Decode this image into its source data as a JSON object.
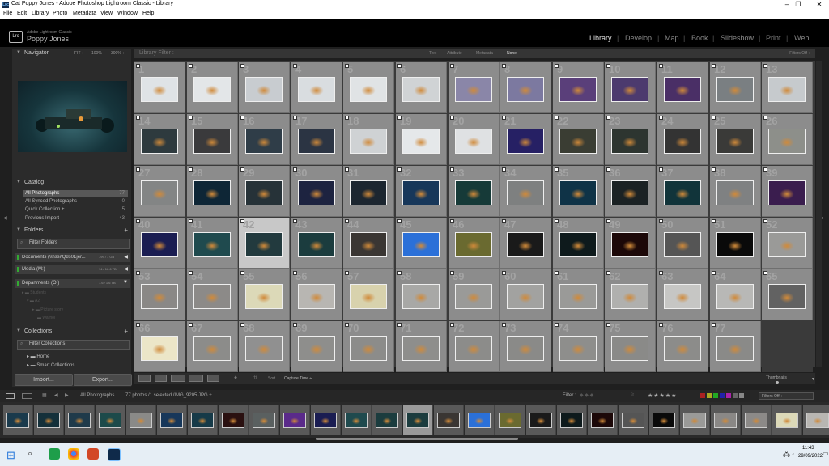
{
  "window": {
    "title": "Cat Poppy Jones - Adobe Photoshop Lightroom Classic - Library",
    "app_icon": "Lrc"
  },
  "menu": [
    "File",
    "Edit",
    "Library",
    "Photo",
    "Metadata",
    "View",
    "Window",
    "Help"
  ],
  "identity": {
    "logo": "Lrc",
    "subtitle": "Adobe Lightroom Classic",
    "name": "Poppy Jones"
  },
  "modules": [
    "Library",
    "Develop",
    "Map",
    "Book",
    "Slideshow",
    "Print",
    "Web"
  ],
  "active_module": "Library",
  "navigator": {
    "title": "Navigator",
    "zoom_options": [
      "FIT ÷",
      "100%",
      "300% ÷"
    ]
  },
  "catalog": {
    "title": "Catalog",
    "items": [
      {
        "label": "All Photographs",
        "count": "77",
        "selected": true
      },
      {
        "label": "All Synced Photographs",
        "count": "0"
      },
      {
        "label": "Quick Collection +",
        "count": "5"
      },
      {
        "label": "Previous Import",
        "count": "43"
      }
    ]
  },
  "folders": {
    "title": "Folders",
    "filter_label": "Filter Folders",
    "volumes": [
      {
        "label": "Documents (\\\\hssi\\Q8s01jer...",
        "stat": "799 / 1 GB"
      },
      {
        "label": "Media (M:)",
        "stat": "14 / 16.6 TB"
      },
      {
        "label": "Departments (O:)",
        "stat": "1.6 / 1.6 TB"
      }
    ],
    "tree": [
      "Students",
      "A2",
      "Picture story",
      "Warhol"
    ]
  },
  "collections": {
    "title": "Collections",
    "filter_label": "Filter Collections",
    "items": [
      "Home",
      "Smart Collections"
    ]
  },
  "left_buttons": {
    "import": "Import...",
    "export": "Export..."
  },
  "filter_bar": {
    "title": "Library Filter :",
    "tabs": [
      "Text",
      "Attribute",
      "Metadata",
      "None"
    ],
    "active_tab": "None",
    "right": "Filters Off ÷"
  },
  "grid": {
    "selected_index": 41,
    "cells": [
      {
        "n": "1",
        "c": "#dfe3e6"
      },
      {
        "n": "2",
        "c": "#e3e6e8"
      },
      {
        "n": "3",
        "c": "#c8ccd0"
      },
      {
        "n": "4",
        "c": "#d9dde0"
      },
      {
        "n": "5",
        "c": "#e0e3e5"
      },
      {
        "n": "6",
        "c": "#d0d3d5"
      },
      {
        "n": "7",
        "c": "#8a86a8"
      },
      {
        "n": "8",
        "c": "#7c79a0"
      },
      {
        "n": "9",
        "c": "#5a3f7a"
      },
      {
        "n": "10",
        "c": "#4c3a6e"
      },
      {
        "n": "11",
        "c": "#4a2f66"
      },
      {
        "n": "12",
        "c": "#7a7f82"
      },
      {
        "n": "13",
        "c": "#c6cacd"
      },
      {
        "n": "14",
        "c": "#2e3a3e"
      },
      {
        "n": "15",
        "c": "#3a3a3c"
      },
      {
        "n": "16",
        "c": "#2f3d48"
      },
      {
        "n": "17",
        "c": "#2b3443"
      },
      {
        "n": "18",
        "c": "#cfd2d4"
      },
      {
        "n": "19",
        "c": "#e5e8ea"
      },
      {
        "n": "20",
        "c": "#dfe1e3"
      },
      {
        "n": "21",
        "c": "#262064"
      },
      {
        "n": "22",
        "c": "#3a3d33"
      },
      {
        "n": "23",
        "c": "#2d3530"
      },
      {
        "n": "24",
        "c": "#333"
      },
      {
        "n": "25",
        "c": "#3a3a38"
      },
      {
        "n": "26",
        "c": "#8d8f8a"
      },
      {
        "n": "27",
        "c": "#838585"
      },
      {
        "n": "28",
        "c": "#0e2636"
      },
      {
        "n": "29",
        "c": "#263238"
      },
      {
        "n": "30",
        "c": "#1d2340"
      },
      {
        "n": "31",
        "c": "#1c2630"
      },
      {
        "n": "32",
        "c": "#17375a"
      },
      {
        "n": "33",
        "c": "#163a38"
      },
      {
        "n": "34",
        "c": "#7e8080"
      },
      {
        "n": "35",
        "c": "#0f3347"
      },
      {
        "n": "36",
        "c": "#1b2224"
      },
      {
        "n": "37",
        "c": "#11343a"
      },
      {
        "n": "38",
        "c": "#7f8182"
      },
      {
        "n": "39",
        "c": "#3a1d4e"
      },
      {
        "n": "40",
        "c": "#1a1d52"
      },
      {
        "n": "41",
        "c": "#1f4a4e"
      },
      {
        "n": "42",
        "c": "#223a3e"
      },
      {
        "n": "43",
        "c": "#1b3c3e"
      },
      {
        "n": "44",
        "c": "#3a3633"
      },
      {
        "n": "45",
        "c": "#2b70d8"
      },
      {
        "n": "46",
        "c": "#6a6a30"
      },
      {
        "n": "47",
        "c": "#1a1a1a"
      },
      {
        "n": "48",
        "c": "#0e1a1c"
      },
      {
        "n": "49",
        "c": "#1c0808"
      },
      {
        "n": "50",
        "c": "#555555"
      },
      {
        "n": "51",
        "c": "#0a0a0a"
      },
      {
        "n": "52",
        "c": "#9a9a98"
      },
      {
        "n": "53",
        "c": "#8a8886"
      },
      {
        "n": "54",
        "c": "#8c8a88"
      },
      {
        "n": "55",
        "c": "#dcd9b8"
      },
      {
        "n": "56",
        "c": "#b8b6b2"
      },
      {
        "n": "57",
        "c": "#d8d2ad"
      },
      {
        "n": "58",
        "c": "#a8a8a6"
      },
      {
        "n": "59",
        "c": "#9a9a98"
      },
      {
        "n": "60",
        "c": "#a2a2a0"
      },
      {
        "n": "61",
        "c": "#9a9a98"
      },
      {
        "n": "62",
        "c": "#b0b0ae"
      },
      {
        "n": "63",
        "c": "#c6c6c4"
      },
      {
        "n": "64",
        "c": "#b8b8b6"
      },
      {
        "n": "65",
        "c": "#626262"
      },
      {
        "n": "66",
        "c": "#ece6c8"
      },
      {
        "n": "67",
        "c": "#8c8c8a"
      },
      {
        "n": "68",
        "c": "#909090"
      },
      {
        "n": "69",
        "c": "#8e8e8c"
      },
      {
        "n": "70",
        "c": "#8c8c8a"
      },
      {
        "n": "71",
        "c": "#8e8e8c"
      },
      {
        "n": "72",
        "c": "#8c8c8a"
      },
      {
        "n": "73",
        "c": "#8a8a88"
      },
      {
        "n": "74",
        "c": "#8e8e8c"
      },
      {
        "n": "75",
        "c": "#8a8a88"
      },
      {
        "n": "76",
        "c": "#8c8c8a"
      },
      {
        "n": "77",
        "c": "#8a8a88"
      }
    ]
  },
  "toolbar": {
    "sort_label": "Sort",
    "sort_value": "Capture Time ÷",
    "thumbnails_label": "Thumbnails"
  },
  "filmstrip_bar": {
    "source": "All Photographs",
    "summary": "77 photos /1 selected /IMG_9205.JPG ÷",
    "filter_label": "Filter :",
    "filters_off": "Filters Off ÷"
  },
  "filmstrip": [
    "#1a3a4c",
    "#14303a",
    "#1f3a4a",
    "#1c4a4a",
    "#8a8a88",
    "#17375a",
    "#163a48",
    "#2a1010",
    "#5a6060",
    "#5a2a8a",
    "#1a1d52",
    "#1f4a4e",
    "#1b3c3e",
    "#1b3c3e",
    "#3a3633",
    "#2b70d8",
    "#6a6a30",
    "#1a1a1a",
    "#0e1a1c",
    "#1c0808",
    "#555555",
    "#0a0a0a",
    "#9a9a98",
    "#8a8886",
    "#8c8a88",
    "#dcd9b8",
    "#b8b6b2"
  ],
  "filmstrip_selected": 13,
  "taskbar": {
    "time": "11:43",
    "date": "29/09/2022"
  }
}
